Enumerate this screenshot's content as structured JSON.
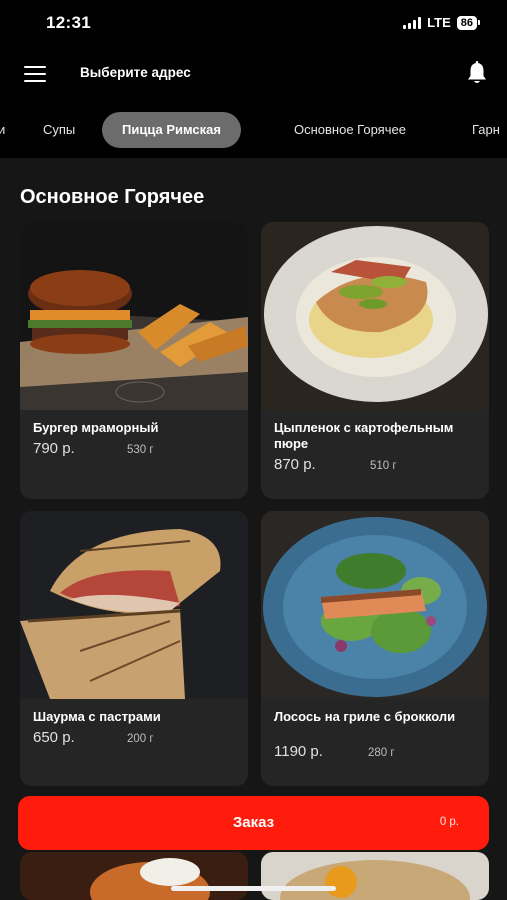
{
  "status_bar": {
    "time": "12:31",
    "network": "LTE",
    "battery": "86"
  },
  "header": {
    "address_prompt": "Выберите адрес",
    "menu_icon": "hamburger-menu-icon",
    "bell_icon": "bell-icon"
  },
  "tabs": [
    {
      "label": "и"
    },
    {
      "label": "Супы"
    },
    {
      "label": "Пицца Римская",
      "active": true
    },
    {
      "label": "Основное Горячее"
    },
    {
      "label": "Гарн"
    }
  ],
  "section": {
    "title": "Основное Горячее"
  },
  "products": [
    {
      "name": "Бургер мраморный",
      "price": "790 р.",
      "weight": "530 г"
    },
    {
      "name": "Цыпленок с картофельным пюре",
      "price": "870 р.",
      "weight": "510 г"
    },
    {
      "name": "Шаурма с пастрами",
      "price": "650 р.",
      "weight": "200 г"
    },
    {
      "name": "Лосось на гриле с брокколи",
      "price": "1190 р.",
      "weight": "280 г"
    }
  ],
  "order": {
    "label": "Заказ",
    "total": "0 р."
  },
  "colors": {
    "accent": "#ff1c0c",
    "background": "#161616",
    "card": "#252525",
    "active_tab": "#6c6c6c"
  }
}
